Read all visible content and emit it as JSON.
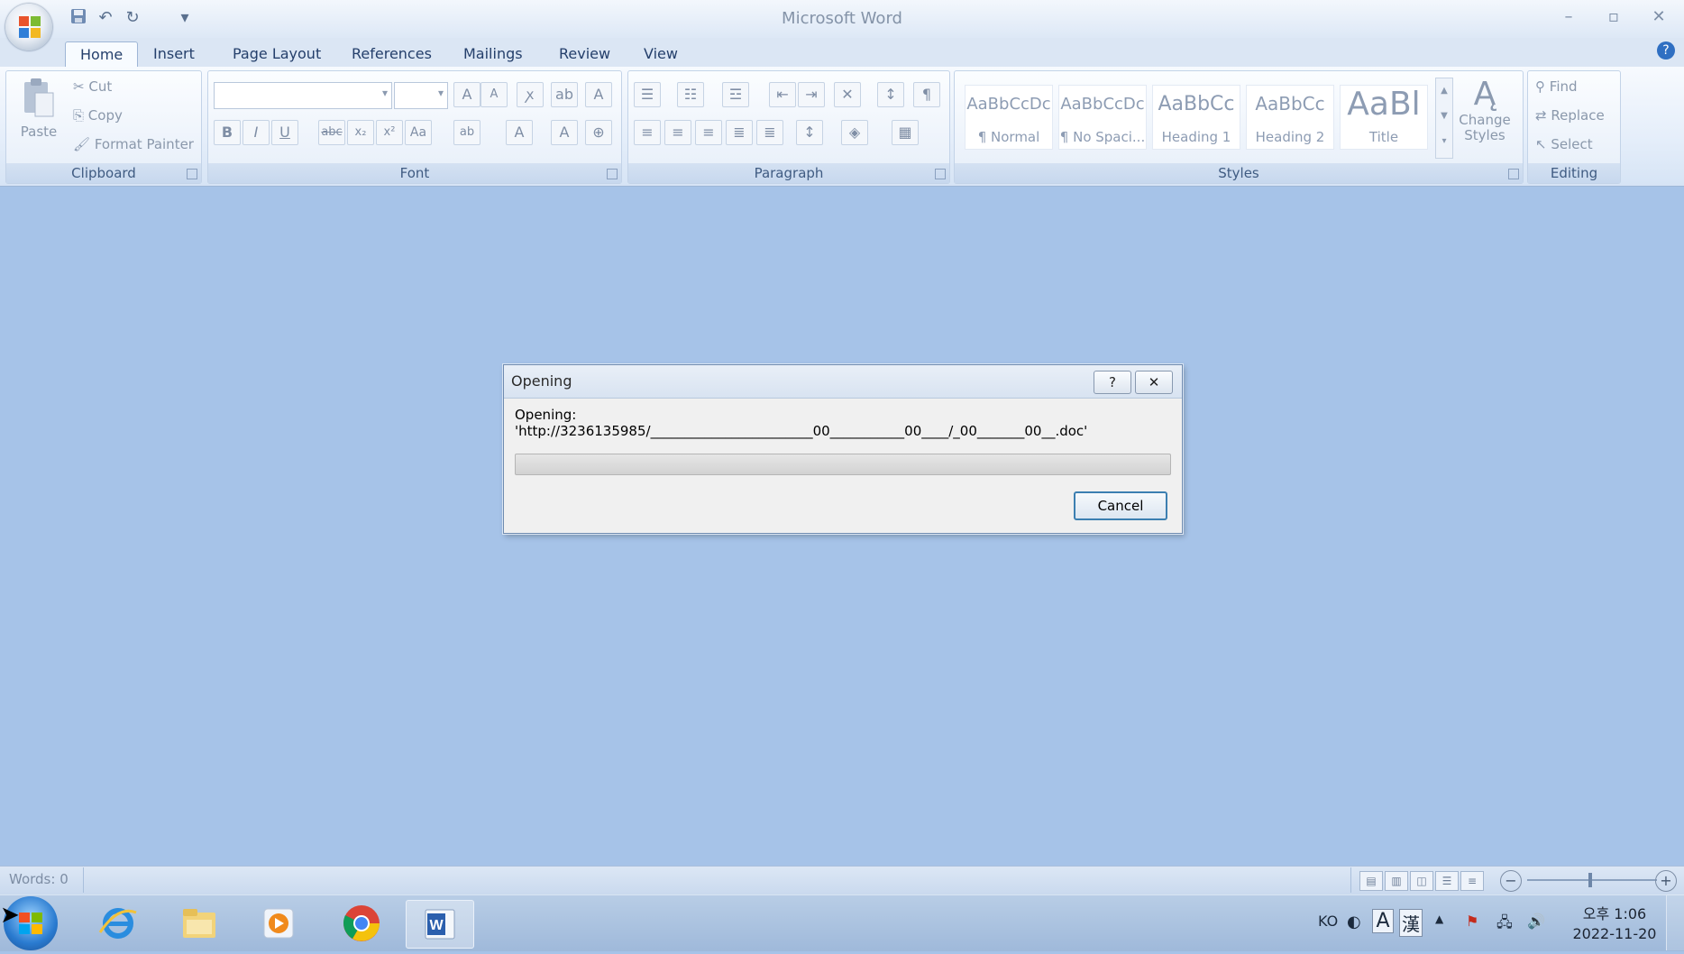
{
  "window": {
    "title": "Microsoft Word",
    "controls": {
      "minimize": "–",
      "restore": "▫",
      "close": "✕"
    }
  },
  "qat": {
    "save_icon": "save-icon",
    "undo_icon": "undo-icon",
    "redo_icon": "redo-icon",
    "customize": "▾"
  },
  "tabs": [
    {
      "label": "Home"
    },
    {
      "label": "Insert"
    },
    {
      "label": "Page Layout"
    },
    {
      "label": "References"
    },
    {
      "label": "Mailings"
    },
    {
      "label": "Review"
    },
    {
      "label": "View"
    }
  ],
  "help_icon": "?",
  "clipboard": {
    "group_label": "Clipboard",
    "paste": "Paste",
    "cut": "Cut",
    "copy": "Copy",
    "format_painter": "Format Painter"
  },
  "font": {
    "group_label": "Font",
    "font_name": "",
    "font_size": "",
    "grow": "A",
    "shrink": "A",
    "clear": "A",
    "bold": "B",
    "italic": "I",
    "underline": "U",
    "strike": "abc",
    "subscript": "x₂",
    "superscript": "x²",
    "change_case": "Aa",
    "highlight": "ab",
    "font_color": "A"
  },
  "paragraph": {
    "group_label": "Paragraph",
    "show_marks": "¶"
  },
  "styles": {
    "group_label": "Styles",
    "items": [
      {
        "sample": "AaBbCcDc",
        "name": "¶ Normal"
      },
      {
        "sample": "AaBbCcDc",
        "name": "¶ No Spaci..."
      },
      {
        "sample": "AaBbCc",
        "name": "Heading 1"
      },
      {
        "sample": "AaBbCc",
        "name": "Heading 2"
      },
      {
        "sample": "AaBl",
        "name": "Title"
      }
    ],
    "change_styles": "Change Styles"
  },
  "editing": {
    "group_label": "Editing",
    "find": "Find",
    "replace": "Replace",
    "select": "Select"
  },
  "dialog": {
    "title": "Opening",
    "help": "?",
    "close": "✕",
    "label": "Opening:",
    "path": "'http://3236135985/________________________00___________00____/_00_______00__.doc'",
    "progress": 0,
    "cancel": "Cancel"
  },
  "status": {
    "words": "Words: 0",
    "zoom_out": "−",
    "zoom_in": "+"
  },
  "taskbar": {
    "apps": [
      "start-orb",
      "internet-explorer",
      "file-explorer",
      "media-player",
      "chrome",
      "word"
    ],
    "ime_lang": "KO",
    "ime_mode": "A",
    "ime_hanja": "漢",
    "time": "오후 1:06",
    "date": "2022-11-20"
  }
}
